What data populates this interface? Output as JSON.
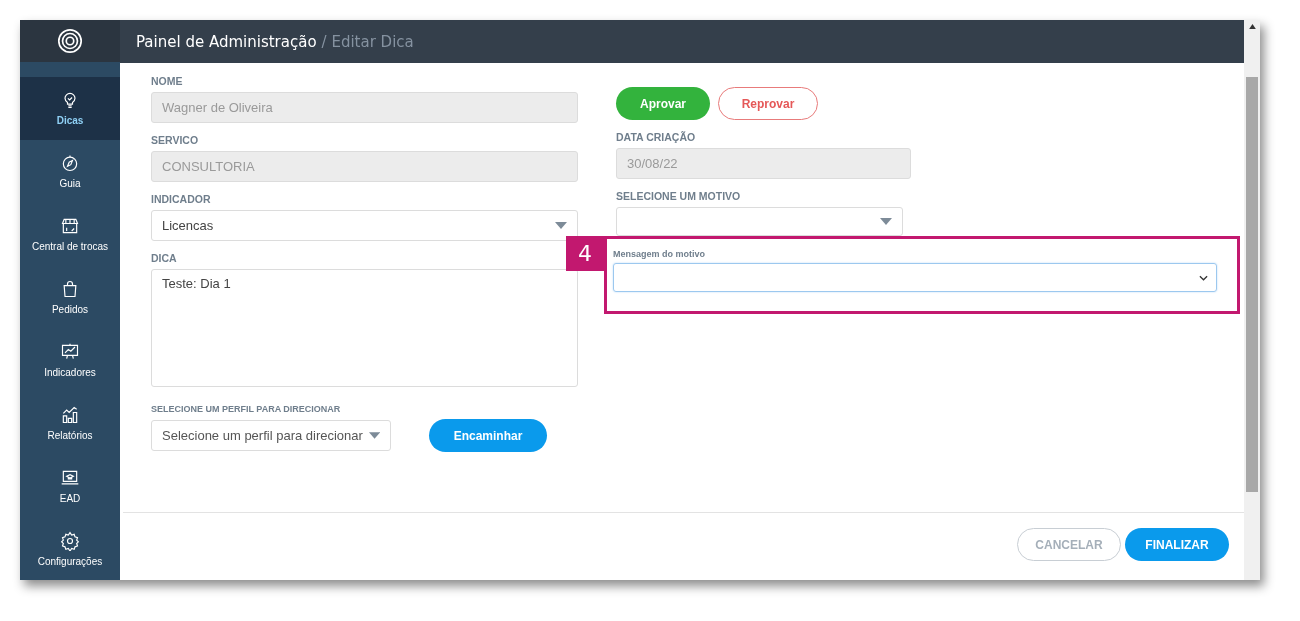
{
  "header": {
    "title": "Painel de Administração",
    "breadcrumb": "/ Editar Dica"
  },
  "sidebar": {
    "items": [
      {
        "label": "Dicas",
        "selected": true
      },
      {
        "label": "Guia",
        "selected": false
      },
      {
        "label": "Central de trocas",
        "selected": false
      },
      {
        "label": "Pedidos",
        "selected": false
      },
      {
        "label": "Indicadores",
        "selected": false
      },
      {
        "label": "Relatórios",
        "selected": false
      },
      {
        "label": "EAD",
        "selected": false
      },
      {
        "label": "Configurações",
        "selected": false
      }
    ]
  },
  "left_fields": [
    {
      "label": "NOME",
      "kind": "input",
      "value": "Wagner de Oliveira",
      "disabled": true
    },
    {
      "label": "SERVICO",
      "kind": "input",
      "value": "CONSULTORIA",
      "disabled": true
    },
    {
      "label": "INDICADOR",
      "kind": "select",
      "value": "Licencas",
      "disabled": false
    },
    {
      "label": "DICA",
      "kind": "textarea",
      "value": "Teste: Dia 1",
      "disabled": false
    }
  ],
  "profile": {
    "label": "SELECIONE UM PERFIL PARA DIRECIONAR",
    "placeholder": "Selecione um perfil para direcionar",
    "button": "Encaminhar"
  },
  "review_buttons": [
    {
      "label": "Aprovar",
      "kind": "primary"
    },
    {
      "label": "Reprovar",
      "kind": "outline"
    }
  ],
  "right_fields": [
    {
      "label": "DATA CRIAÇÃO",
      "kind": "input",
      "value": "30/08/22",
      "disabled": true
    },
    {
      "label": "SELECIONE UM MOTIVO",
      "kind": "select",
      "disabled": false
    }
  ],
  "callout": {
    "number": "4",
    "label": "Mensagem do motivo"
  },
  "footer_buttons": [
    {
      "label": "CANCELAR",
      "kind": "outline"
    },
    {
      "label": "FINALIZAR",
      "kind": "primary"
    }
  ]
}
